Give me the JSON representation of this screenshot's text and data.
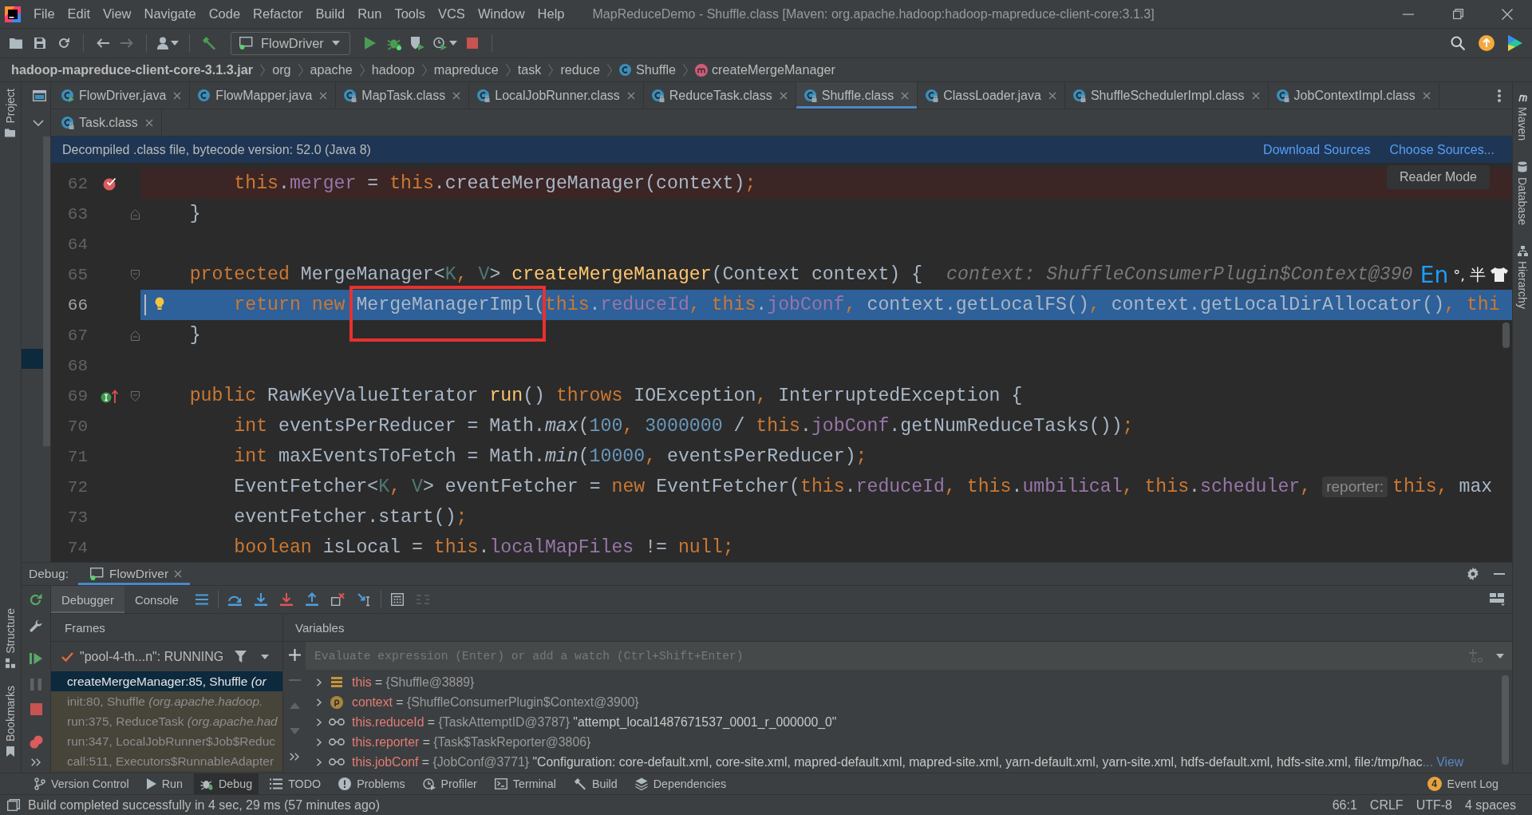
{
  "menu_bar": {
    "items": [
      "File",
      "Edit",
      "View",
      "Navigate",
      "Code",
      "Refactor",
      "Build",
      "Run",
      "Tools",
      "VCS",
      "Window",
      "Help"
    ],
    "title": "MapReduceDemo - Shuffle.class [Maven: org.apache.hadoop:hadoop-mapreduce-client-core:3.1.3]"
  },
  "toolbar": {
    "run_configuration": "FlowDriver"
  },
  "breadcrumb": [
    {
      "label": "hadoop-mapreduce-client-core-3.1.3.jar",
      "kind": "archive"
    },
    {
      "label": "org",
      "kind": "package"
    },
    {
      "label": "apache",
      "kind": "package"
    },
    {
      "label": "hadoop",
      "kind": "package"
    },
    {
      "label": "mapreduce",
      "kind": "package"
    },
    {
      "label": "task",
      "kind": "package"
    },
    {
      "label": "reduce",
      "kind": "package"
    },
    {
      "label": "Shuffle",
      "kind": "class"
    },
    {
      "label": "createMergeManager",
      "kind": "method"
    }
  ],
  "editor_tabs": [
    {
      "label": "FlowDriver.java",
      "kind": "runnable",
      "selected": false
    },
    {
      "label": "FlowMapper.java",
      "kind": "source",
      "selected": false
    },
    {
      "label": "MapTask.class",
      "kind": "locked",
      "selected": false
    },
    {
      "label": "LocalJobRunner.class",
      "kind": "locked",
      "selected": false
    },
    {
      "label": "ReduceTask.class",
      "kind": "locked",
      "selected": false
    },
    {
      "label": "Shuffle.class",
      "kind": "locked",
      "selected": true
    },
    {
      "label": "ClassLoader.java",
      "kind": "locked",
      "selected": false
    },
    {
      "label": "ShuffleSchedulerImpl.class",
      "kind": "locked",
      "selected": false
    },
    {
      "label": "JobContextImpl.class",
      "kind": "locked",
      "selected": false
    }
  ],
  "editor_tabs_second_row": [
    {
      "label": "Task.class",
      "kind": "locked",
      "selected": false
    }
  ],
  "project_panel": {
    "highlighted_row": true
  },
  "banner": {
    "message": "Decompiled .class file, bytecode version: 52.0 (Java 8)",
    "links": [
      "Download Sources",
      "Choose Sources..."
    ]
  },
  "editor": {
    "reader_mode": "Reader Mode",
    "lines": [
      {
        "number": "62",
        "breakpoint": true,
        "segments": [
          {
            "kind": "code",
            "tokens": [
              {
                "kind": "keyword",
                "text": "        this"
              },
              {
                "kind": "plain",
                "text": "."
              },
              {
                "kind": "field",
                "text": "merger"
              },
              {
                "kind": "plain",
                "text": " = "
              },
              {
                "kind": "keyword",
                "text": "this"
              },
              {
                "kind": "plain",
                "text": ".createMergeManager(context)"
              },
              {
                "kind": "keyword",
                "text": ";"
              }
            ]
          }
        ]
      },
      {
        "number": "63",
        "fold_end": true,
        "segments": [
          {
            "kind": "code",
            "tokens": [
              {
                "kind": "plain",
                "text": "    }"
              }
            ]
          }
        ]
      },
      {
        "number": "64"
      },
      {
        "number": "65",
        "fold_start": true,
        "segments": [
          {
            "kind": "code",
            "tokens": [
              {
                "kind": "keyword",
                "text": "    protected"
              },
              {
                "kind": "plain",
                "text": " MergeManager<"
              },
              {
                "kind": "typeparam",
                "text": "K"
              },
              {
                "kind": "keyword",
                "text": ","
              },
              {
                "kind": "typeparam",
                "text": " V"
              },
              {
                "kind": "plain",
                "text": "> "
              },
              {
                "kind": "declaration",
                "text": "createMergeManager"
              },
              {
                "kind": "plain",
                "text": "(Context context) {"
              }
            ]
          },
          {
            "kind": "value",
            "text": "context: ShuffleConsumerPlugin$Context@390"
          }
        ]
      },
      {
        "number": "66",
        "execution_point": true,
        "caret": true,
        "intention": true,
        "boxed": true,
        "segments": [
          {
            "kind": "code",
            "tokens": [
              {
                "kind": "keyword",
                "text": "        return new"
              },
              {
                "kind": "plain",
                "text": " MergeManagerImpl("
              },
              {
                "kind": "keyword",
                "text": "this"
              },
              {
                "kind": "plain",
                "text": "."
              },
              {
                "kind": "field",
                "text": "reduceId"
              },
              {
                "kind": "keyword",
                "text": ","
              },
              {
                "kind": "keyword",
                "text": " this"
              },
              {
                "kind": "plain",
                "text": "."
              },
              {
                "kind": "field",
                "text": "jobConf"
              },
              {
                "kind": "keyword",
                "text": ","
              },
              {
                "kind": "plain",
                "text": " context.getLocalFS()"
              },
              {
                "kind": "keyword",
                "text": ","
              },
              {
                "kind": "plain",
                "text": " context.getLocalDirAllocator()"
              },
              {
                "kind": "keyword",
                "text": ","
              },
              {
                "kind": "keyword",
                "text": " thi"
              }
            ]
          }
        ]
      },
      {
        "number": "67",
        "fold_end": true,
        "segments": [
          {
            "kind": "code",
            "tokens": [
              {
                "kind": "plain",
                "text": "    }"
              }
            ]
          }
        ]
      },
      {
        "number": "68"
      },
      {
        "number": "69",
        "implements": true,
        "fold_start": true,
        "segments": [
          {
            "kind": "code",
            "tokens": [
              {
                "kind": "keyword",
                "text": "    public"
              },
              {
                "kind": "plain",
                "text": " RawKeyValueIterator "
              },
              {
                "kind": "declaration",
                "text": "run"
              },
              {
                "kind": "plain",
                "text": "() "
              },
              {
                "kind": "keyword",
                "text": "throws"
              },
              {
                "kind": "plain",
                "text": " IOException"
              },
              {
                "kind": "keyword",
                "text": ","
              },
              {
                "kind": "plain",
                "text": " InterruptedException {"
              }
            ]
          }
        ]
      },
      {
        "number": "70",
        "segments": [
          {
            "kind": "code",
            "tokens": [
              {
                "kind": "keyword",
                "text": "        int"
              },
              {
                "kind": "plain",
                "text": " eventsPerReducer = Math."
              },
              {
                "kind": "static",
                "text": "max"
              },
              {
                "kind": "plain",
                "text": "("
              },
              {
                "kind": "number",
                "text": "100"
              },
              {
                "kind": "keyword",
                "text": ","
              },
              {
                "kind": "number",
                "text": " 3000000"
              },
              {
                "kind": "plain",
                "text": " / "
              },
              {
                "kind": "keyword",
                "text": "this"
              },
              {
                "kind": "plain",
                "text": "."
              },
              {
                "kind": "field",
                "text": "jobConf"
              },
              {
                "kind": "plain",
                "text": ".getNumReduceTasks())"
              },
              {
                "kind": "keyword",
                "text": ";"
              }
            ]
          }
        ]
      },
      {
        "number": "71",
        "segments": [
          {
            "kind": "code",
            "tokens": [
              {
                "kind": "keyword",
                "text": "        int"
              },
              {
                "kind": "plain",
                "text": " maxEventsToFetch = Math."
              },
              {
                "kind": "static",
                "text": "min"
              },
              {
                "kind": "plain",
                "text": "("
              },
              {
                "kind": "number",
                "text": "10000"
              },
              {
                "kind": "keyword",
                "text": ","
              },
              {
                "kind": "plain",
                "text": " eventsPerReducer)"
              },
              {
                "kind": "keyword",
                "text": ";"
              }
            ]
          }
        ]
      },
      {
        "number": "72",
        "segments": [
          {
            "kind": "code",
            "tokens": [
              {
                "kind": "plain",
                "text": "        EventFetcher<"
              },
              {
                "kind": "typeparam",
                "text": "K"
              },
              {
                "kind": "keyword",
                "text": ","
              },
              {
                "kind": "typeparam",
                "text": " V"
              },
              {
                "kind": "plain",
                "text": "> eventFetcher = "
              },
              {
                "kind": "keyword",
                "text": "new"
              },
              {
                "kind": "plain",
                "text": " EventFetcher("
              },
              {
                "kind": "keyword",
                "text": "this"
              },
              {
                "kind": "plain",
                "text": "."
              },
              {
                "kind": "field",
                "text": "reduceId"
              },
              {
                "kind": "keyword",
                "text": ","
              },
              {
                "kind": "keyword",
                "text": " this"
              },
              {
                "kind": "plain",
                "text": "."
              },
              {
                "kind": "field",
                "text": "umbilical"
              },
              {
                "kind": "keyword",
                "text": ","
              },
              {
                "kind": "keyword",
                "text": " this"
              },
              {
                "kind": "plain",
                "text": "."
              },
              {
                "kind": "field",
                "text": "scheduler"
              },
              {
                "kind": "keyword",
                "text": ","
              }
            ]
          },
          {
            "kind": "hint",
            "text": "reporter:"
          },
          {
            "kind": "code",
            "tokens": [
              {
                "kind": "keyword",
                "text": "this"
              },
              {
                "kind": "keyword",
                "text": ","
              },
              {
                "kind": "plain",
                "text": " max"
              }
            ]
          }
        ]
      },
      {
        "number": "73",
        "segments": [
          {
            "kind": "code",
            "tokens": [
              {
                "kind": "plain",
                "text": "        eventFetcher.start()"
              },
              {
                "kind": "keyword",
                "text": ";"
              }
            ]
          }
        ]
      },
      {
        "number": "74",
        "segments": [
          {
            "kind": "code",
            "tokens": [
              {
                "kind": "keyword",
                "text": "        boolean"
              },
              {
                "kind": "plain",
                "text": " isLocal = "
              },
              {
                "kind": "keyword",
                "text": "this"
              },
              {
                "kind": "plain",
                "text": "."
              },
              {
                "kind": "field",
                "text": "localMapFiles"
              },
              {
                "kind": "plain",
                "text": " != "
              },
              {
                "kind": "keyword",
                "text": "null"
              },
              {
                "kind": "keyword",
                "text": ";"
              }
            ]
          }
        ]
      }
    ]
  },
  "ime_toolbar": {
    "language": "En",
    "punctuation": "°,",
    "width": "半"
  },
  "debug": {
    "label": "Debug:",
    "sessions": [
      {
        "label": "FlowDriver",
        "selected": true
      }
    ],
    "tabs": [
      {
        "label": "Debugger",
        "selected": true
      },
      {
        "label": "Console",
        "selected": false
      }
    ],
    "frames": {
      "title": "Frames",
      "thread": "\"pool-4-th...n\": RUNNING",
      "items": [
        {
          "location": "createMergeManager:85, Shuffle",
          "package": "(or",
          "selected": true,
          "kind": "library"
        },
        {
          "location": "init:80, Shuffle",
          "package": "(org.apache.hadoop.",
          "selected": false,
          "kind": "library"
        },
        {
          "location": "run:375, ReduceTask",
          "package": "(org.apache.had",
          "selected": false,
          "kind": "library"
        },
        {
          "location": "run:347, LocalJobRunner$Job$Reduc",
          "selected": false,
          "kind": "library"
        },
        {
          "location": "call:511, Executors$RunnableAdapter",
          "selected": false,
          "kind": "library"
        }
      ]
    },
    "variables": {
      "title": "Variables",
      "placeholder": "Evaluate expression (Enter) or add a watch (Ctrl+Shift+Enter)",
      "items": [
        {
          "kind": "object",
          "expanded": false,
          "name": "this",
          "operator": "=",
          "type": "{Shuffle@3889}"
        },
        {
          "kind": "parameter",
          "expanded": false,
          "name": "context",
          "operator": "=",
          "type": "{ShuffleConsumerPlugin$Context@3900}"
        },
        {
          "kind": "field",
          "expanded": false,
          "name": "this.reduceId",
          "operator": "=",
          "type": "{TaskAttemptID@3787}",
          "value": "\"attempt_local1487671537_0001_r_000000_0\""
        },
        {
          "kind": "field",
          "expanded": false,
          "name": "this.reporter",
          "operator": "=",
          "type": "{Task$TaskReporter@3806}"
        },
        {
          "kind": "field",
          "expanded": false,
          "name": "this.jobConf",
          "operator": "=",
          "type": "{JobConf@3771}",
          "value": "\"Configuration: core-default.xml, core-site.xml, mapred-default.xml, mapred-site.xml, yarn-default.xml, yarn-site.xml, hdfs-default.xml, hdfs-site.xml, file:/tmp/hac",
          "link": "... View"
        }
      ]
    }
  },
  "tool_stripes": {
    "left_top": [
      {
        "label": "Project",
        "kind": "project"
      }
    ],
    "left_bottom": [
      {
        "label": "Structure",
        "kind": "structure"
      },
      {
        "label": "Bookmarks",
        "kind": "bookmarks"
      }
    ],
    "right": [
      {
        "label": "Maven",
        "kind": "maven"
      },
      {
        "label": "Database",
        "kind": "database"
      },
      {
        "label": "Hierarchy",
        "kind": "hierarchy"
      }
    ]
  },
  "tool_window_bar": {
    "items": [
      {
        "label": "Version Control",
        "kind": "vcs",
        "selected": false
      },
      {
        "label": "Run",
        "kind": "run",
        "selected": false
      },
      {
        "label": "Debug",
        "kind": "debug",
        "selected": true
      },
      {
        "label": "TODO",
        "kind": "todo",
        "selected": false
      },
      {
        "label": "Problems",
        "kind": "problems",
        "selected": false
      },
      {
        "label": "Profiler",
        "kind": "profiler",
        "selected": false
      },
      {
        "label": "Terminal",
        "kind": "terminal",
        "selected": false
      },
      {
        "label": "Build",
        "kind": "build",
        "selected": false
      },
      {
        "label": "Dependencies",
        "kind": "dependencies",
        "selected": false
      }
    ],
    "event_log": {
      "label": "Event Log",
      "count": "4"
    }
  },
  "status_bar": {
    "message": "Build completed successfully in 4 sec, 29 ms (57 minutes ago)",
    "position": "66:1",
    "line_separator": "CRLF",
    "encoding": "UTF-8",
    "indent": "4 spaces"
  }
}
